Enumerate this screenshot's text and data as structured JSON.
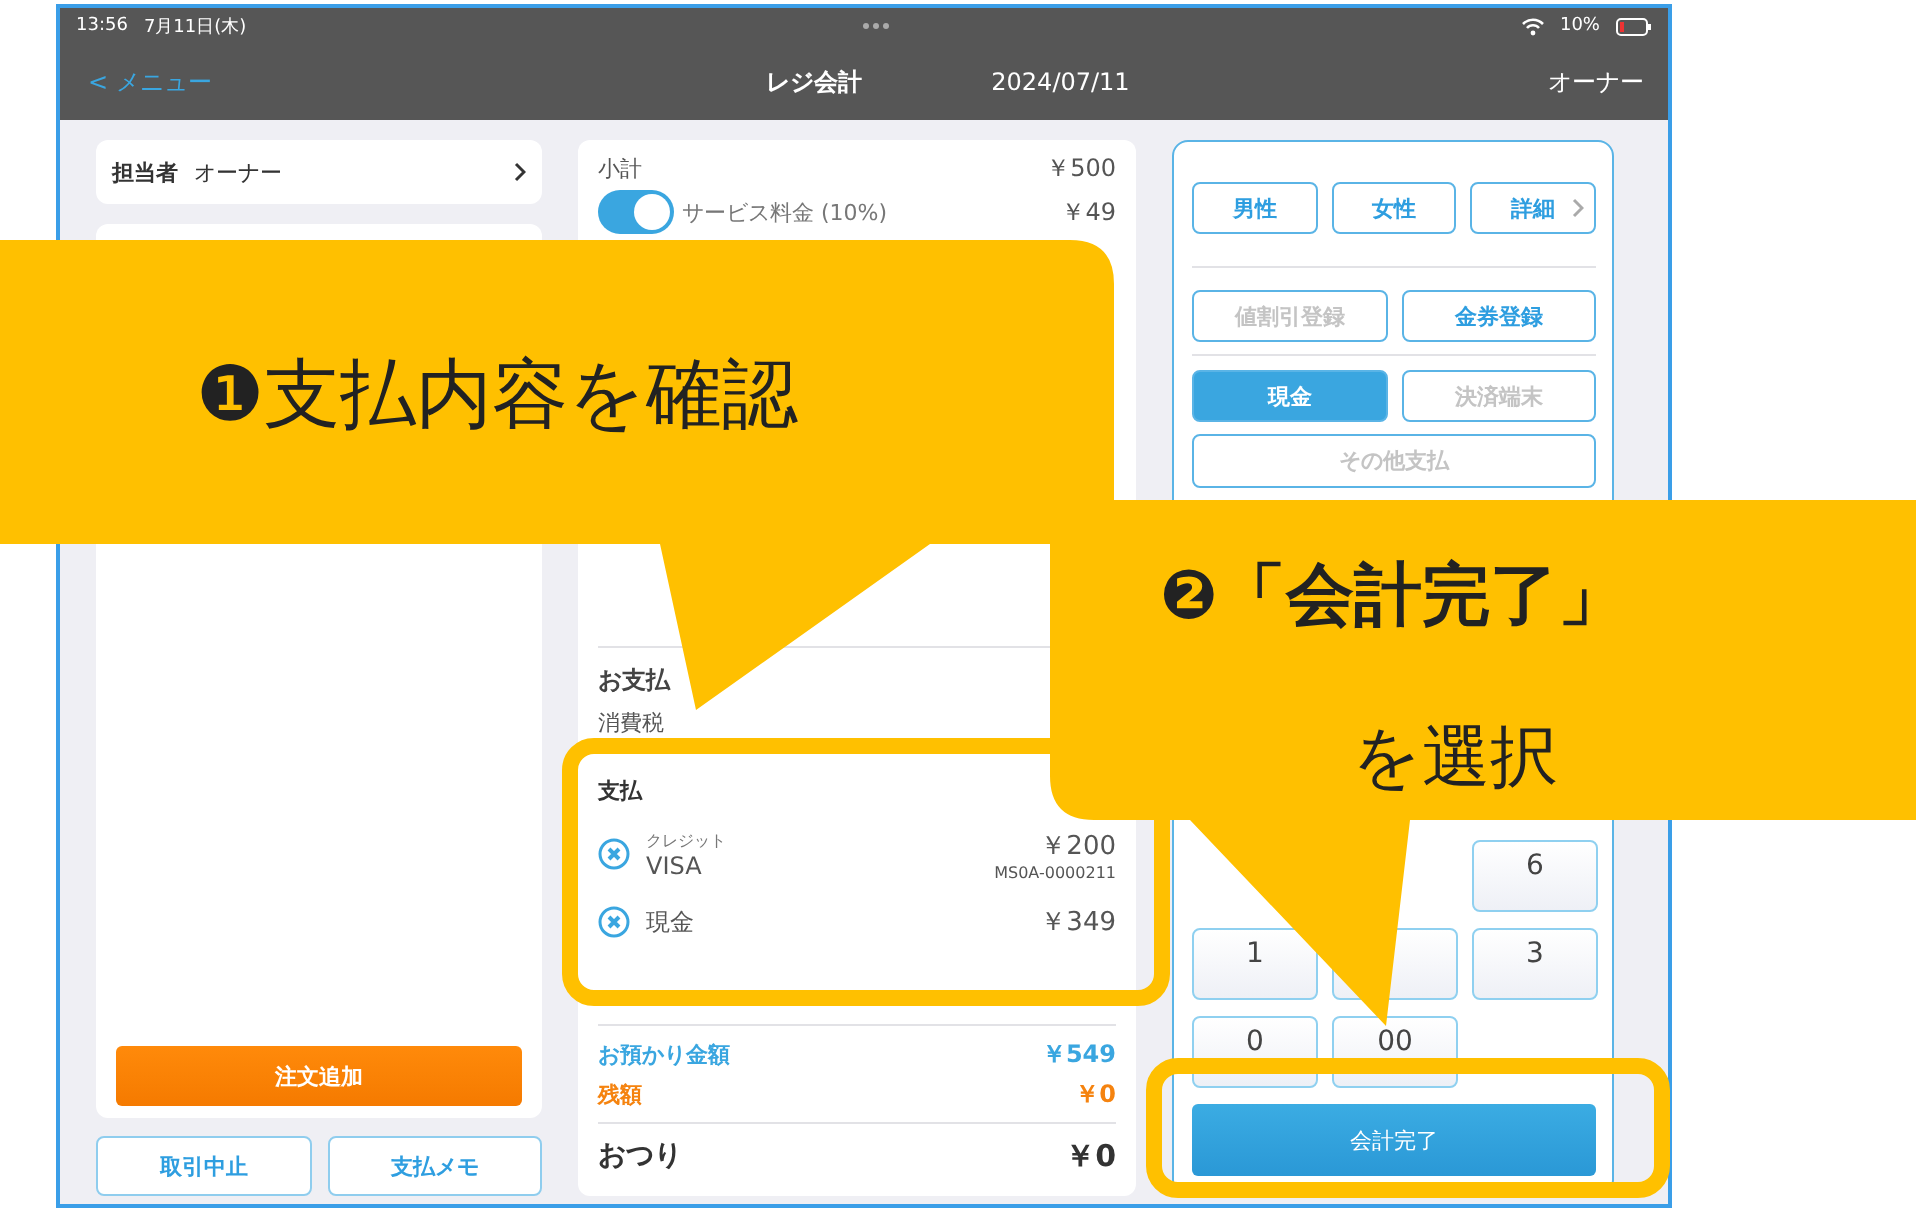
{
  "status_bar": {
    "time": "13:56",
    "date": "7月11日(木)",
    "battery": "10%"
  },
  "nav": {
    "back": "< メニュー",
    "title": "レジ会計",
    "date": "2024/07/11",
    "user": "オーナー"
  },
  "staff": {
    "label": "担当者",
    "value": "オーナー"
  },
  "order_button": "注文追加",
  "footer_buttons": [
    "取引中止",
    "支払メモ"
  ],
  "summary": {
    "subtotal": {
      "label": "小計",
      "value": "￥500"
    },
    "service": {
      "label": "サービス料金 (10%)",
      "value": "￥49",
      "on": true
    },
    "total_label": "お支払",
    "tax_label": "消費税"
  },
  "payments": {
    "title": "支払",
    "items": [
      {
        "type": "クレジット",
        "name": "VISA",
        "amount": "￥200",
        "ref": "MS0A-0000211"
      },
      {
        "name": "現金",
        "amount": "￥349"
      }
    ]
  },
  "totals": {
    "deposit": {
      "label": "お預かり金額",
      "value": "￥549"
    },
    "balance": {
      "label": "残額",
      "value": "￥0"
    },
    "change": {
      "label": "おつり",
      "value": "￥0"
    }
  },
  "customer_buttons": [
    {
      "label": "男性",
      "kind": "plain"
    },
    {
      "label": "女性",
      "kind": "plain"
    },
    {
      "label": "詳細",
      "kind": "more"
    }
  ],
  "discount_buttons": [
    {
      "label": "値割引登録",
      "disabled": true
    },
    {
      "label": "金券登録",
      "disabled": false
    }
  ],
  "payment_methods": [
    {
      "label": "現金",
      "selected": true,
      "disabled": false
    },
    {
      "label": "決済端末",
      "selected": false,
      "disabled": true
    }
  ],
  "other_payment": "その他支払",
  "keypad": [
    {
      "kind": "key",
      "label": "6"
    },
    {
      "kind": "key",
      "label": "1"
    },
    {
      "kind": "covered"
    },
    {
      "kind": "key",
      "label": "3"
    },
    {
      "kind": "key",
      "label": "0"
    },
    {
      "kind": "key",
      "label": "00"
    }
  ],
  "complete_button": "会計完了",
  "callouts": [
    {
      "title": "❶支払内容を確認"
    },
    {
      "title": "❷「会計完了」",
      "subtitle": "を選択"
    }
  ]
}
